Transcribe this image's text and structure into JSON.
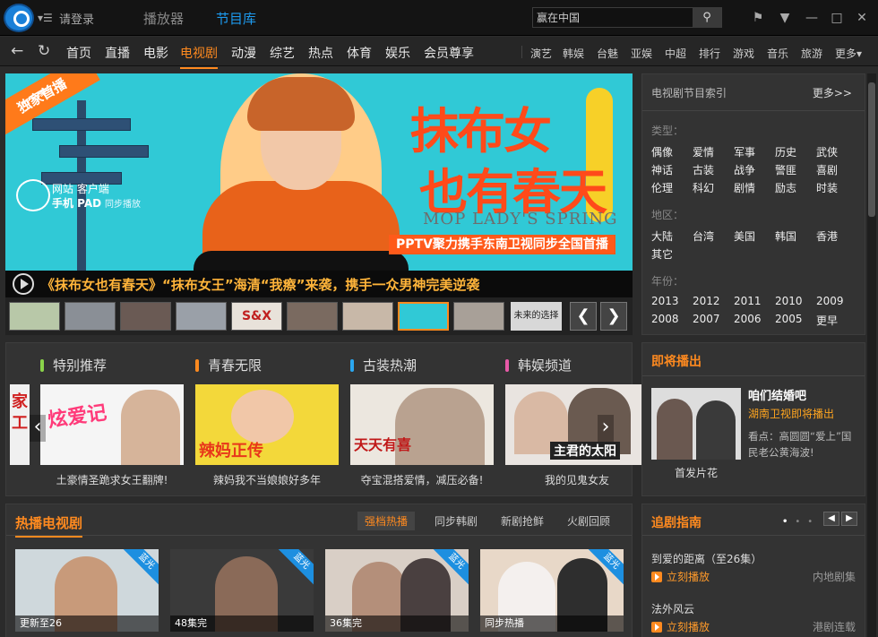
{
  "titlebar": {
    "login": "请登录",
    "tabs": [
      "播放器",
      "节目库"
    ],
    "search_value": "赢在中国"
  },
  "nav": {
    "main": [
      "首页",
      "直播",
      "电影",
      "电视剧",
      "动漫",
      "综艺",
      "热点",
      "体育",
      "娱乐",
      "会员尊享"
    ],
    "sub": [
      "演艺",
      "韩娱",
      "台魅",
      "亚娱",
      "中超",
      "排行",
      "游戏",
      "音乐",
      "旅游",
      "更多▾"
    ]
  },
  "banner": {
    "exclusive": "独家首播",
    "exclusive_brand": "PPTV聚力",
    "cloud_line1": "网站 客户端",
    "cloud_line2": "手机 PAD",
    "cloud_sync": "同步播放",
    "title_line1": "抹布女",
    "title_line2": "也有春天",
    "title_en": "MOP LADY'S SPRING",
    "slogan": "PPTV聚力携手东南卫视同步全国首播",
    "caption": "《抹布女也有春天》“抹布女王”海清“我瘵”来袭，携手一众男神完美逆袭",
    "thumb_label": "未来的选择",
    "thumb_text": "S&X"
  },
  "index_panel": {
    "title": "电视剧节目索引",
    "more": "更多>>",
    "type_label": "类型：",
    "types": [
      "偶像",
      "爱情",
      "军事",
      "历史",
      "武侠",
      "神话",
      "古装",
      "战争",
      "警匪",
      "喜剧",
      "伦理",
      "科幻",
      "剧情",
      "励志",
      "时装"
    ],
    "region_label": "地区：",
    "regions": [
      "大陆",
      "台湾",
      "美国",
      "韩国",
      "香港",
      "其它"
    ],
    "year_label": "年份：",
    "years": [
      "2013",
      "2012",
      "2011",
      "2010",
      "2009",
      "2008",
      "2007",
      "2006",
      "2005",
      "更早"
    ]
  },
  "channels": {
    "tabs": [
      {
        "label": "特别推荐",
        "color": "#8ad34a"
      },
      {
        "label": "青春无限",
        "color": "#ff8a1f"
      },
      {
        "label": "古装热潮",
        "color": "#2aa7f0"
      },
      {
        "label": "韩娱频道",
        "color": "#e85aa8"
      }
    ],
    "cards": [
      {
        "caption": "土豪情圣跪求女王翻牌!",
        "title": "炫爱记",
        "color": "#f5f5f5"
      },
      {
        "caption": "辣妈我不当娘娘好多年",
        "title": "辣妈正传",
        "color": "#f3d83a"
      },
      {
        "caption": "夺宝混搭爱情，减压必备!",
        "title": "天天有喜",
        "color": "#ece7df"
      },
      {
        "caption": "我的见鬼女友",
        "title": "主君的太阳",
        "color": "#e9e4e0"
      }
    ],
    "left_edge_text": "家 工"
  },
  "upcoming": {
    "title": "即将播出",
    "show": "咱们结婚吧",
    "station": "湖南卫视即将播出",
    "desc": "看点：高圆圆“爱上”国民老公黄海波!",
    "caption": "首发片花"
  },
  "hot": {
    "title": "热播电视剧",
    "tabs": [
      "强档热播",
      "同步韩剧",
      "新剧抢鲜",
      "火剧回顾"
    ],
    "ribbon": "蓝光",
    "cards": [
      {
        "overlay": "更新至26",
        "color": "#cfd8dc"
      },
      {
        "overlay": "48集完",
        "color": "#3a3a3a"
      },
      {
        "overlay": "36集完",
        "color": "#d9cfc6"
      },
      {
        "overlay": "同步热播",
        "color": "#e8d8c8"
      }
    ]
  },
  "guide": {
    "title": "追剧指南",
    "items": [
      {
        "show": "到爱的距离（至26集）",
        "play": "立刻播放",
        "category": "内地剧集"
      },
      {
        "show": "法外风云",
        "play": "立刻播放",
        "category": "港剧连载"
      }
    ]
  },
  "colors": {
    "accent": "#ff8a1f",
    "brand_blue": "#1d9bf0",
    "banner_bg": "#30c9d6",
    "title_red": "#ff4a1a"
  }
}
